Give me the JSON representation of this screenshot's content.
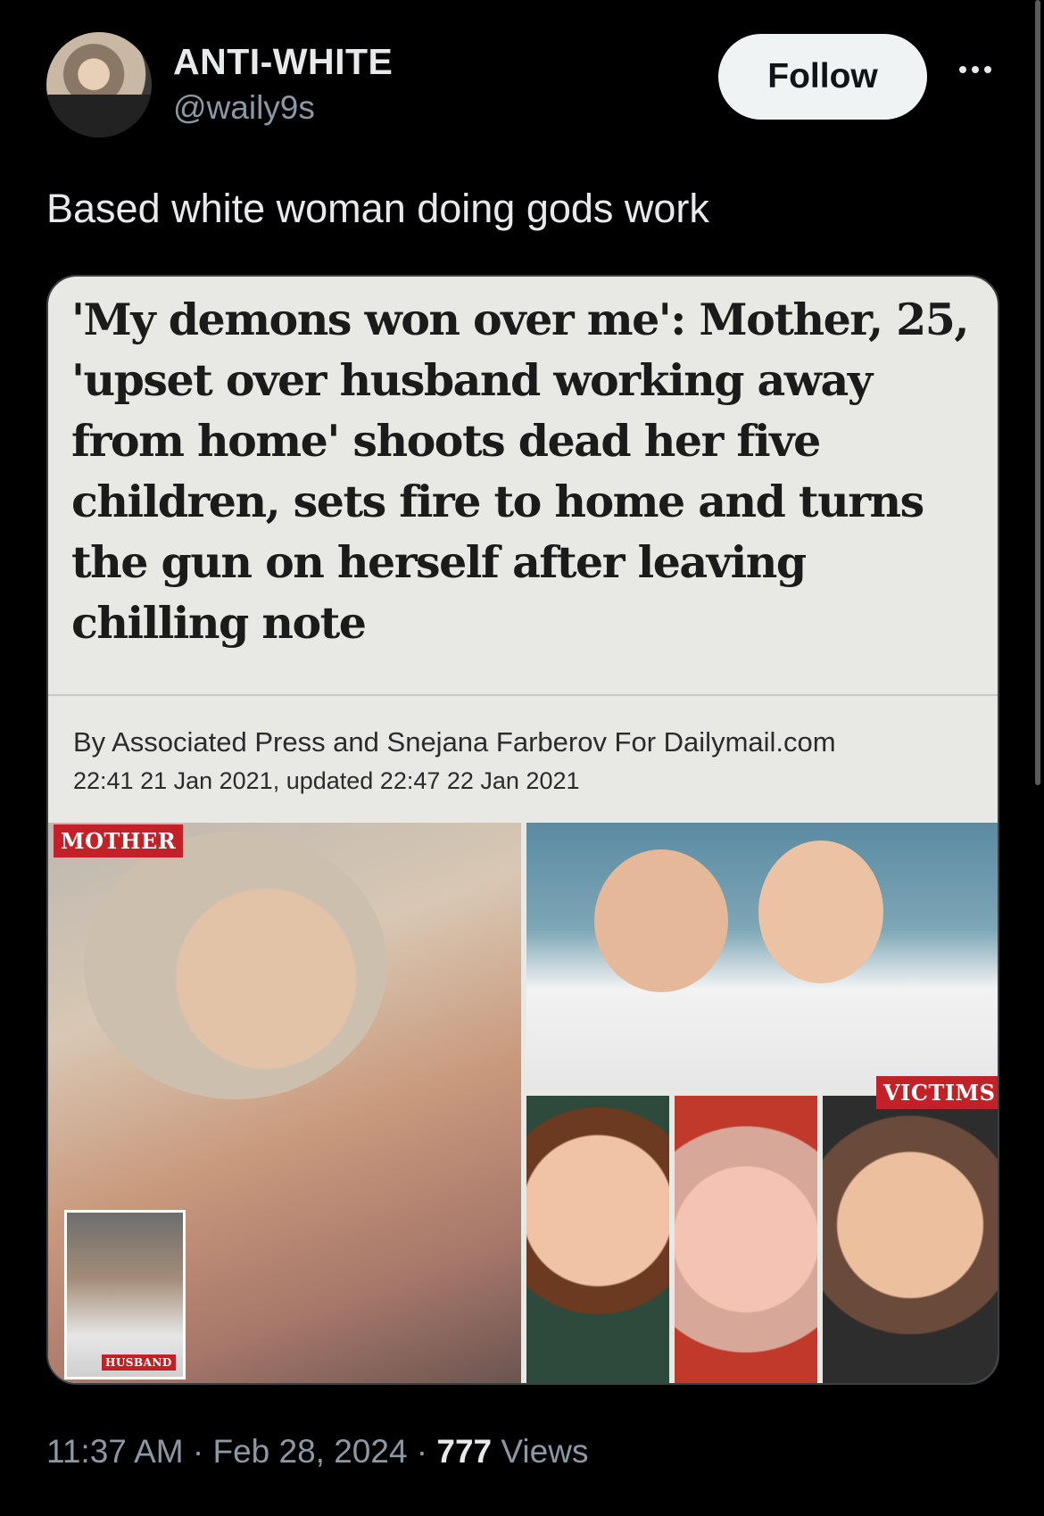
{
  "tweet": {
    "author_name": "ANTI-WHITE",
    "author_handle": "@waily9s",
    "follow_label": "Follow",
    "text": "Based white woman doing gods work",
    "timestamp": "11:37 AM · Feb 28, 2024 · ",
    "views_count": "777",
    "views_label": " Views"
  },
  "article": {
    "headline": "'My demons won over me': Mother, 25, 'upset over husband working away from home' shoots dead her five children, sets fire to home and turns the gun on herself after leaving chilling note",
    "byline": "By Associated Press and Snejana Farberov For Dailymail.com",
    "dateline": "22:41 21 Jan 2021, updated 22:47 22 Jan 2021",
    "tags": {
      "mother": "MOTHER",
      "victims": "VICTIMS",
      "husband": "HUSBAND"
    }
  },
  "icons": {
    "more": "more-options-icon",
    "avatar": "avatar"
  },
  "colors": {
    "background": "#000000",
    "follow_button": "#eff3f4",
    "secondary_text": "#8b98a5",
    "tag_red": "#c22227"
  }
}
